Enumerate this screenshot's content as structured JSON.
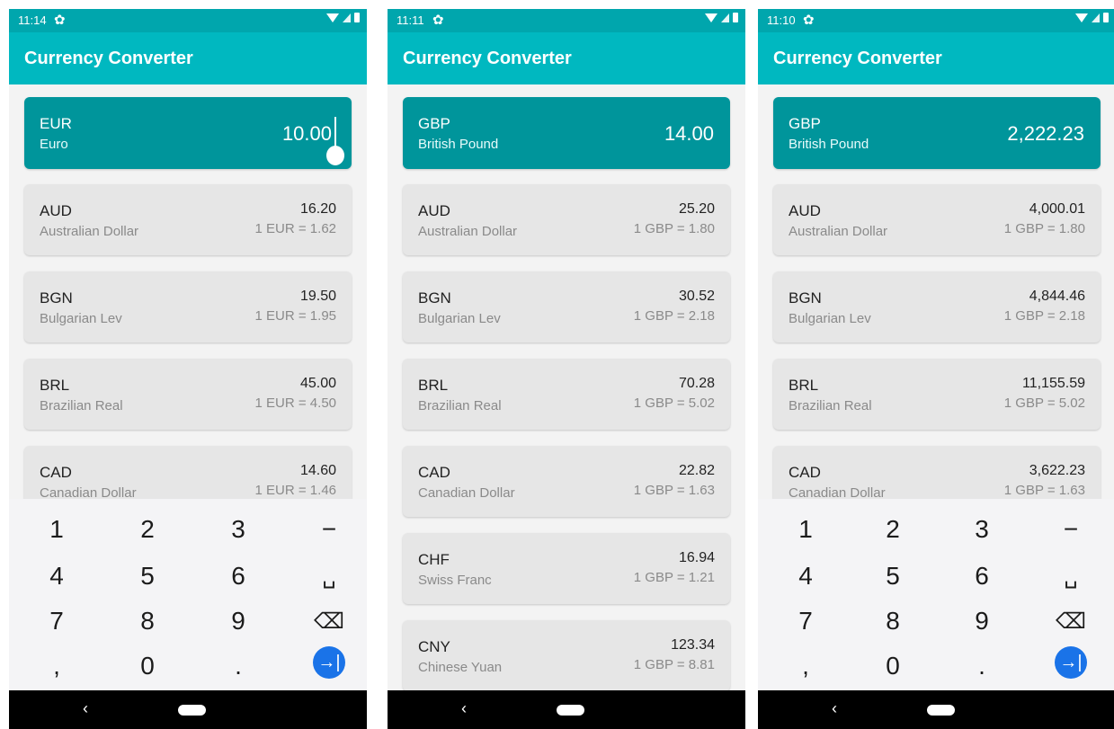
{
  "screens": [
    {
      "status_time": "11:14",
      "app_title": "Currency Converter",
      "base": {
        "code": "EUR",
        "name": "Euro",
        "amount": "10.00"
      },
      "items": [
        {
          "code": "AUD",
          "name": "Australian Dollar",
          "value": "16.20",
          "rate": "1 EUR = 1.62"
        },
        {
          "code": "BGN",
          "name": "Bulgarian Lev",
          "value": "19.50",
          "rate": "1 EUR = 1.95"
        },
        {
          "code": "BRL",
          "name": "Brazilian Real",
          "value": "45.00",
          "rate": "1 EUR = 4.50"
        },
        {
          "code": "CAD",
          "name": "Canadian Dollar",
          "value": "14.60",
          "rate": "1 EUR = 1.46"
        }
      ],
      "keyboard": true
    },
    {
      "status_time": "11:11",
      "app_title": "Currency Converter",
      "base": {
        "code": "GBP",
        "name": "British Pound",
        "amount": "14.00"
      },
      "items": [
        {
          "code": "AUD",
          "name": "Australian Dollar",
          "value": "25.20",
          "rate": "1 GBP = 1.80"
        },
        {
          "code": "BGN",
          "name": "Bulgarian Lev",
          "value": "30.52",
          "rate": "1 GBP = 2.18"
        },
        {
          "code": "BRL",
          "name": "Brazilian Real",
          "value": "70.28",
          "rate": "1 GBP = 5.02"
        },
        {
          "code": "CAD",
          "name": "Canadian Dollar",
          "value": "22.82",
          "rate": "1 GBP = 1.63"
        },
        {
          "code": "CHF",
          "name": "Swiss Franc",
          "value": "16.94",
          "rate": "1 GBP = 1.21"
        },
        {
          "code": "CNY",
          "name": "Chinese Yuan",
          "value": "123.34",
          "rate": "1 GBP = 8.81"
        }
      ],
      "keyboard": false
    },
    {
      "status_time": "11:10",
      "app_title": "Currency Converter",
      "base": {
        "code": "GBP",
        "name": "British Pound",
        "amount": "2,222.23"
      },
      "items": [
        {
          "code": "AUD",
          "name": "Australian Dollar",
          "value": "4,000.01",
          "rate": "1 GBP = 1.80"
        },
        {
          "code": "BGN",
          "name": "Bulgarian Lev",
          "value": "4,844.46",
          "rate": "1 GBP = 2.18"
        },
        {
          "code": "BRL",
          "name": "Brazilian Real",
          "value": "11,155.59",
          "rate": "1 GBP = 5.02"
        },
        {
          "code": "CAD",
          "name": "Canadian Dollar",
          "value": "3,622.23",
          "rate": "1 GBP = 1.63"
        }
      ],
      "keyboard": true
    }
  ],
  "keypad": {
    "keys": [
      "1",
      "2",
      "3",
      "−",
      "4",
      "5",
      "6",
      "␣",
      "7",
      "8",
      "9",
      "⌫",
      ",",
      "0",
      ".",
      "→|"
    ]
  },
  "icons": {
    "settings": "gear-icon",
    "wifi": "wifi-icon",
    "signal": "signal-icon",
    "battery": "battery-icon",
    "back": "back-icon",
    "home": "home-icon",
    "backspace": "backspace-icon",
    "enter": "enter-icon"
  },
  "colors": {
    "status_bar": "#00a6ad",
    "app_bar": "#00b8c0",
    "base_card": "#00959b",
    "card": "#e6e6e6",
    "enter_key": "#1a73e8",
    "nav_bar": "#000000"
  }
}
